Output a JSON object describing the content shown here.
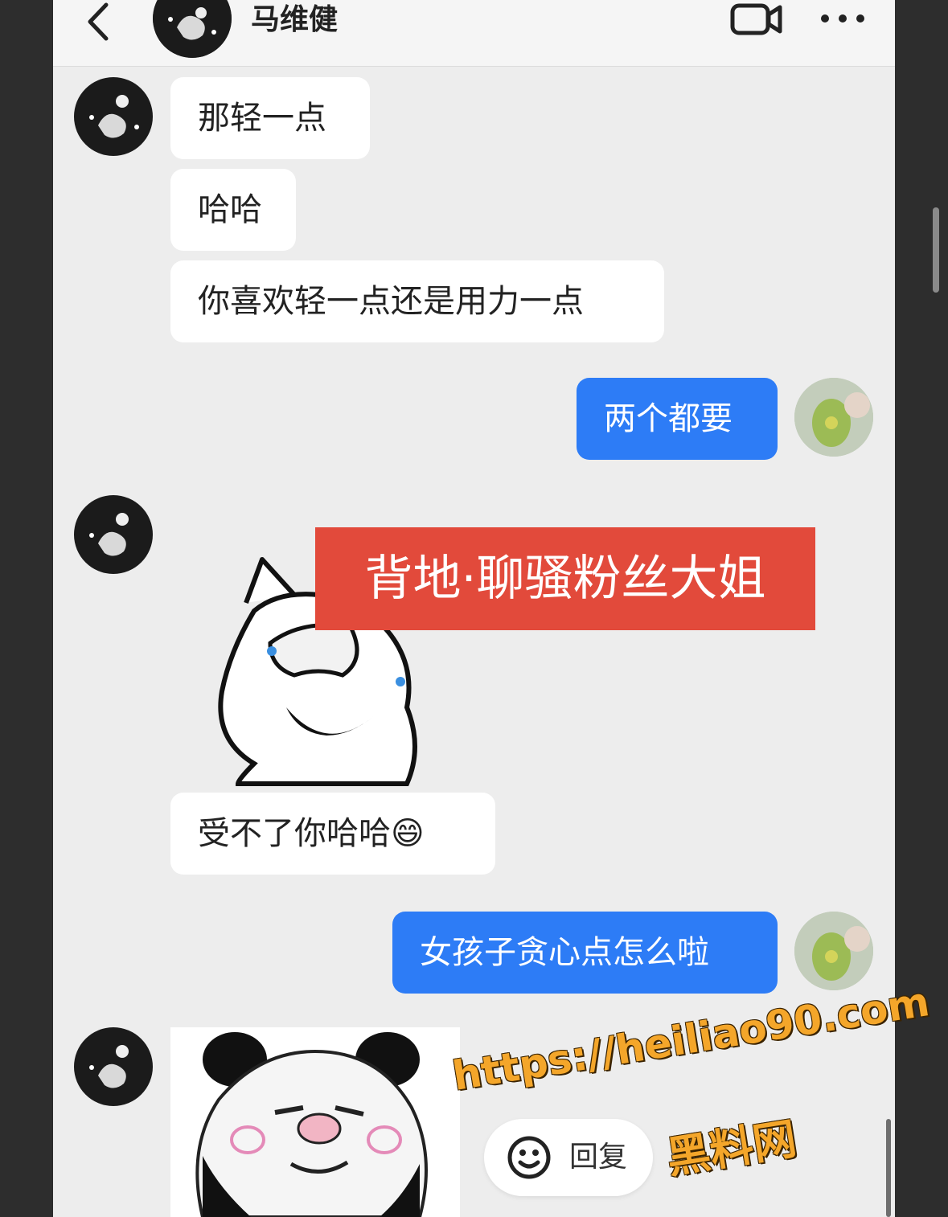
{
  "header": {
    "contact_name": "马维健",
    "back_icon": "chevron-left-icon",
    "video_icon": "video-call-icon",
    "more_icon": "more-dots-icon"
  },
  "messages": [
    {
      "side": "left",
      "text": "那轻一点"
    },
    {
      "side": "left",
      "text": "哈哈"
    },
    {
      "side": "left",
      "text": "你喜欢轻一点还是用力一点"
    },
    {
      "side": "right",
      "text": "两个都要"
    },
    {
      "side": "left",
      "type": "sticker",
      "sticker": "cover-face-laughing-cat"
    },
    {
      "side": "left",
      "text": "受不了你哈哈😄"
    },
    {
      "side": "right",
      "text": "女孩子贪心点怎么啦"
    },
    {
      "side": "left",
      "type": "sticker",
      "sticker": "panda-face-meme"
    }
  ],
  "overlay_banner": "背地·聊骚粉丝大姐",
  "reply_button": {
    "label": "回复",
    "icon": "smiley-icon"
  },
  "watermark": {
    "url": "https://heiliao90.com",
    "name": "黑料网"
  },
  "colors": {
    "my_bubble": "#2d7cf6",
    "banner": "#e24a3b",
    "watermark": "#f4a62a"
  }
}
